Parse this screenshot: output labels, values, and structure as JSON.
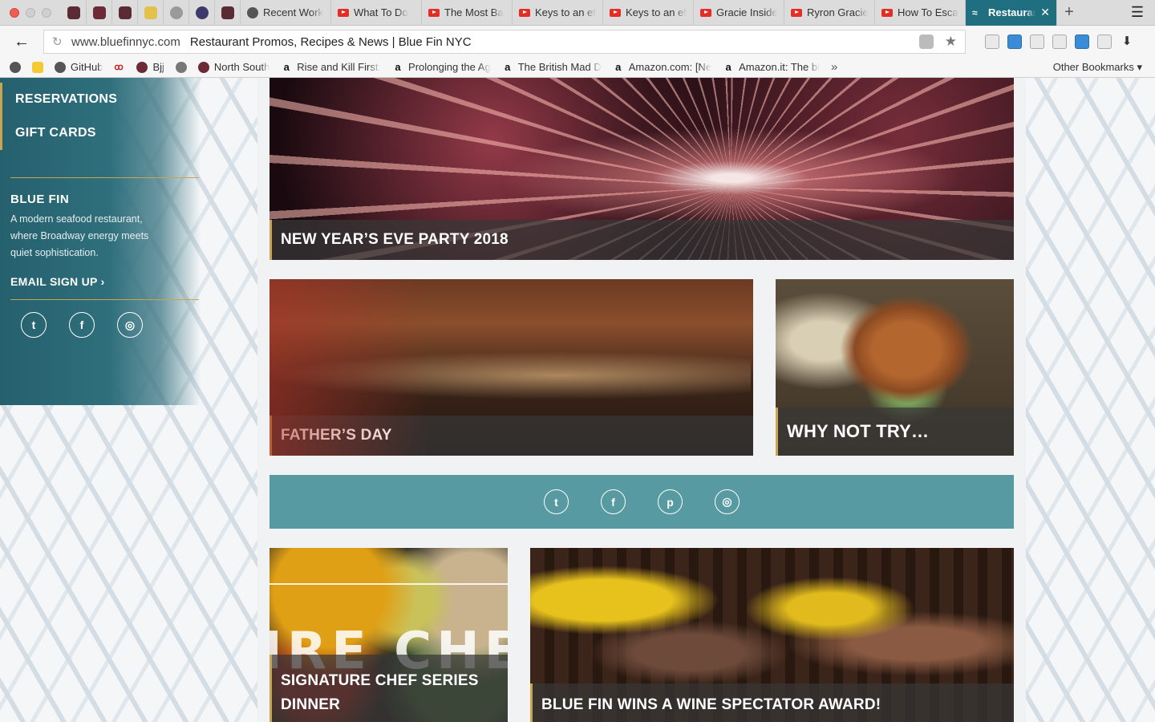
{
  "browser": {
    "tabs": [
      {
        "label": "Recent Work",
        "icon": "github-icon"
      },
      {
        "label": "What To Do",
        "icon": "youtube-icon"
      },
      {
        "label": "The Most Ba",
        "icon": "youtube-icon"
      },
      {
        "label": "Keys to an ef",
        "icon": "youtube-icon"
      },
      {
        "label": "Keys to an ef",
        "icon": "youtube-icon"
      },
      {
        "label": "Gracie Inside",
        "icon": "youtube-icon"
      },
      {
        "label": "Ryron Gracie",
        "icon": "youtube-icon"
      },
      {
        "label": "How To Esca",
        "icon": "youtube-icon"
      },
      {
        "label": "Restauran",
        "icon": "bluefin-icon",
        "active": true
      }
    ],
    "url_host": "www.bluefinnyc.com",
    "page_title": "Restaurant Promos, Recipes & News | Blue Fin NYC",
    "bookmarks": [
      {
        "label": "GitHub",
        "icon": "github-icon"
      },
      {
        "label": "Bjj",
        "icon": "folder-icon"
      },
      {
        "label": "North South",
        "icon": "folder-icon"
      },
      {
        "label": "Rise and Kill First:",
        "icon": "amazon-icon"
      },
      {
        "label": "Prolonging the Ag",
        "icon": "amazon-icon"
      },
      {
        "label": "The British Mad D",
        "icon": "amazon-icon"
      },
      {
        "label": "Amazon.com: [Ne",
        "icon": "amazon-icon"
      },
      {
        "label": "Amazon.it: The bl",
        "icon": "amazon-icon"
      }
    ],
    "more_bookmarks": "»",
    "other_bookmarks": "Other Bookmarks ▾",
    "active_tab_color": "#1f6f80"
  },
  "sidebar": {
    "links": [
      "RESERVATIONS",
      "GIFT CARDS"
    ],
    "title": "BLUE FIN",
    "description": "A modern seafood restaurant, where Broadway energy meets quiet sophistication.",
    "email_signup": "EMAIL SIGN UP",
    "social": [
      "twitter-icon",
      "facebook-icon",
      "instagram-icon"
    ],
    "accent": "#c9a552",
    "background": "#2f6f7c"
  },
  "cards": {
    "nye": "NEW YEAR’S EVE PARTY 2018",
    "fathers_day": "FATHER’S DAY",
    "why_not": "WHY NOT TRY…",
    "chef_series_1": "SIGNATURE CHEF SERIES",
    "chef_series_2": "DINNER",
    "wine": "BLUE FIN WINS A WINE SPECTATOR AWARD!",
    "spice_image_text": "IRE CHE"
  },
  "social_band": {
    "icons": [
      "twitter-icon",
      "facebook-icon",
      "pinterest-icon",
      "instagram-icon"
    ],
    "color": "#579aa1"
  }
}
